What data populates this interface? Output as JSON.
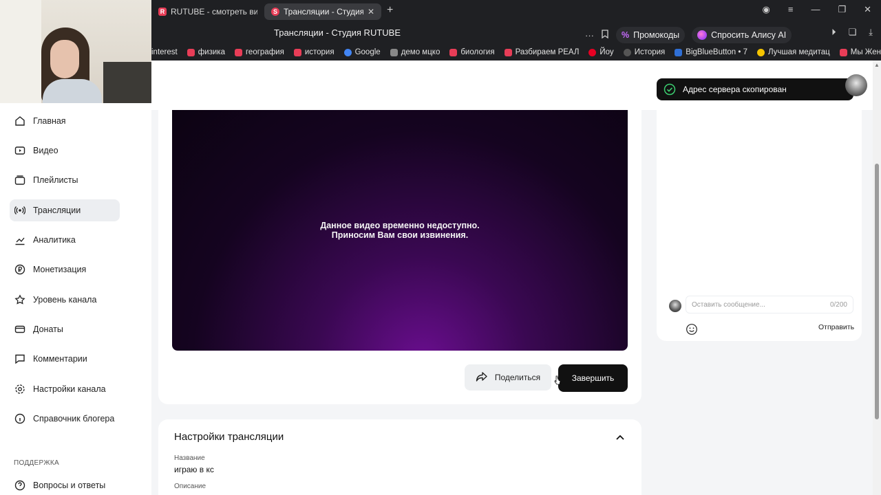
{
  "browser": {
    "tabs": [
      {
        "label": "RUTUBE - смотреть виде",
        "icon": "rutube-icon"
      },
      {
        "label": "Трансляции - Студия R",
        "icon": "studio-icon",
        "active": true
      }
    ],
    "page_title": "Трансляции - Студия RUTUBE",
    "promo_label": "Промокоды",
    "alice_label": "Спросить Алису AI",
    "bookmarks": [
      {
        "label": "interest",
        "color": "#e60023"
      },
      {
        "label": "физика",
        "color": "#e83d57"
      },
      {
        "label": "география",
        "color": "#e83d57"
      },
      {
        "label": "история",
        "color": "#e83d57"
      },
      {
        "label": "Google",
        "color": "#4285f4"
      },
      {
        "label": "демо мцко",
        "color": "#888888"
      },
      {
        "label": "биология",
        "color": "#e83d57"
      },
      {
        "label": "Разбираем РЕАЛ",
        "color": "#e83d57"
      },
      {
        "label": "Йоу",
        "color": "#e60023"
      },
      {
        "label": "История",
        "color": "#555555"
      },
      {
        "label": "BigBlueButton • 7",
        "color": "#2f6fd6"
      },
      {
        "label": "Лучшая медитац",
        "color": "#f5c400"
      },
      {
        "label": "Мы Женимся",
        "color": "#e83d57"
      }
    ]
  },
  "sidebar": {
    "items": [
      {
        "label": "Главная",
        "icon": "home-icon"
      },
      {
        "label": "Видео",
        "icon": "video-icon"
      },
      {
        "label": "Плейлисты",
        "icon": "playlist-icon"
      },
      {
        "label": "Трансляции",
        "icon": "broadcast-icon",
        "active": true
      },
      {
        "label": "Аналитика",
        "icon": "analytics-icon"
      },
      {
        "label": "Монетизация",
        "icon": "ruble-icon"
      },
      {
        "label": "Уровень канала",
        "icon": "star-icon"
      },
      {
        "label": "Донаты",
        "icon": "donate-icon"
      },
      {
        "label": "Комментарии",
        "icon": "comment-icon"
      },
      {
        "label": "Настройки канала",
        "icon": "gear-icon"
      },
      {
        "label": "Справочник блогера",
        "icon": "info-icon"
      }
    ],
    "support_heading": "ПОДДЕРЖКА",
    "support_items": [
      {
        "label": "Вопросы и ответы",
        "icon": "question-icon"
      }
    ]
  },
  "player": {
    "message_line1": "Данное видео временно недоступно.",
    "message_line2": "Приносим Вам свои извинения."
  },
  "actions": {
    "share_label": "Поделиться",
    "finish_label": "Завершить"
  },
  "settings": {
    "title": "Настройки трансляции",
    "name_label": "Название",
    "name_value": "играю в кс",
    "description_label": "Описание"
  },
  "chat": {
    "input_placeholder": "Оставить сообщение...",
    "counter": "0/200",
    "send_label": "Отправить"
  },
  "toast": {
    "message": "Адрес сервера скопирован"
  }
}
